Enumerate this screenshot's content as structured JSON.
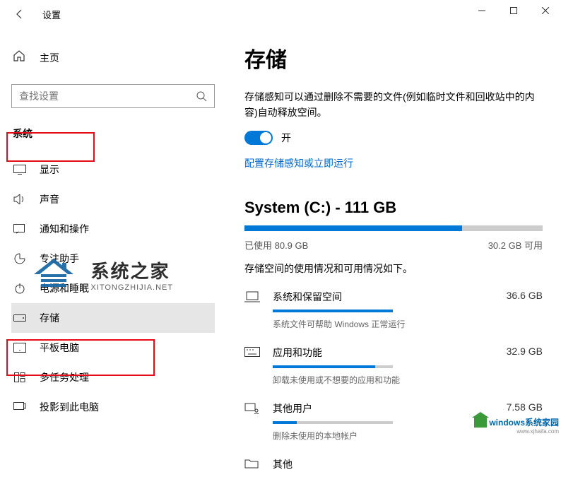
{
  "titlebar": {
    "title": "设置"
  },
  "sidebar": {
    "home": "主页",
    "search_placeholder": "查找设置",
    "section": "系统",
    "items": [
      {
        "label": "显示"
      },
      {
        "label": "声音"
      },
      {
        "label": "通知和操作"
      },
      {
        "label": "专注助手"
      },
      {
        "label": "电源和睡眠"
      },
      {
        "label": "存储"
      },
      {
        "label": "平板电脑"
      },
      {
        "label": "多任务处理"
      },
      {
        "label": "投影到此电脑"
      }
    ]
  },
  "main": {
    "title": "存储",
    "desc": "存储感知可以通过删除不需要的文件(例如临时文件和回收站中的内容)自动释放空间。",
    "toggle_state": "开",
    "link": "配置存储感知或立即运行",
    "drive": {
      "name": "System (C:) - 111 GB",
      "used": "已使用 80.9 GB",
      "free": "30.2 GB 可用",
      "desc": "存储空间的使用情况和可用情况如下。",
      "fill_pct": 73
    },
    "categories": [
      {
        "name": "系统和保留空间",
        "size": "36.6 GB",
        "sub": "系统文件可帮助 Windows 正常运行",
        "fill_pct": 100
      },
      {
        "name": "应用和功能",
        "size": "32.9 GB",
        "sub": "卸载未使用或不想要的应用和功能",
        "fill_pct": 85
      },
      {
        "name": "其他用户",
        "size": "7.58 GB",
        "sub": "删除未使用的本地帐户",
        "fill_pct": 20
      },
      {
        "name": "其他",
        "size": "",
        "sub": "",
        "fill_pct": 0
      }
    ]
  },
  "watermark1": {
    "big": "系统之家",
    "small": "XITONGZHIJIA.NET"
  },
  "watermark2": {
    "text": "windows系统家园",
    "sub": "www.xjhaifa.com"
  }
}
